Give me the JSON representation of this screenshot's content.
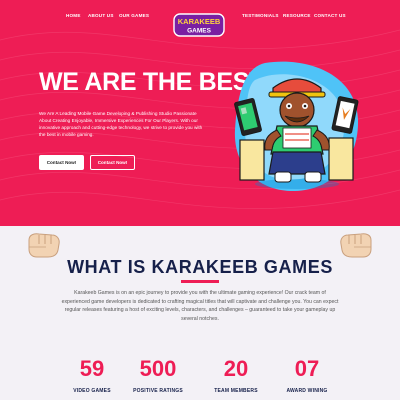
{
  "nav": {
    "items": [
      {
        "label": "HOME"
      },
      {
        "label": "ABOUT US"
      },
      {
        "label": "OUR GAMES"
      },
      {
        "label": "TESTIMONIALS"
      },
      {
        "label": "RESOURCE"
      },
      {
        "label": "CONTACT US"
      }
    ],
    "logo_text": [
      "KARAKEEB",
      "GAMES"
    ]
  },
  "hero": {
    "headline": "WE ARE THE BEST!",
    "description": "We Are A Leading Mobile Game Developing & Publishing Studio Passionate About Creating Enjoyable, Immersive Experiences For Our Players. With our innovative approach and cutting-edge technology, we strive to provide you with the best in mobile gaming.",
    "primary_button": "Contact Now!",
    "secondary_button": "Contact Now!"
  },
  "about": {
    "title": "WHAT IS KARAKEEB GAMES",
    "text": "Karakeeb Games is on an epic journey to provide you with the ultimate gaming experience! Our crack team of experienced game developers is dedicated to crafting magical titles that will captivate and challenge you. You can expect regular releases featuring a host of exciting levels, characters, and challenges – guaranteed to take your gameplay up several notches."
  },
  "stats": [
    {
      "value": "59",
      "label": "VIDEO GAMES"
    },
    {
      "value": "500",
      "label": "POSITIVE RATINGS"
    },
    {
      "value": "20",
      "label": "TEAM MEMBERS"
    },
    {
      "value": "07",
      "label": "AWARD WINING"
    }
  ],
  "colors": {
    "accent": "#ee1d55",
    "navy": "#16204a",
    "background": "#f3f1f6"
  }
}
